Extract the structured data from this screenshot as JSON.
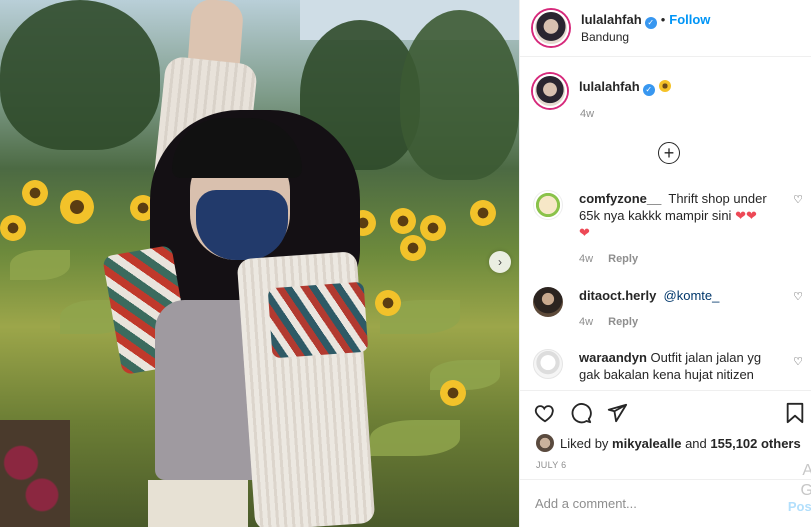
{
  "post": {
    "username": "lulalahfah",
    "location": "Bandung",
    "follow_label": "Follow",
    "separator": "•",
    "verified_icon": "verified-check-icon",
    "caption_time": "4w"
  },
  "comments": [
    {
      "user": "comfyzone__",
      "text": "Thrift shop under 65k nya kakkk mampir sini",
      "time": "4w",
      "reply": "Reply"
    },
    {
      "user": "ditaoct.herly",
      "text": "@komte_",
      "time": "4w",
      "reply": "Reply"
    },
    {
      "user": "waraandyn",
      "text": "Outfit jalan jalan yg gak bakalan kena hujat nitizen"
    }
  ],
  "likes": {
    "prefix": "Liked by",
    "user": "mikyalealle",
    "and": "and",
    "count": "155,102 others"
  },
  "date": "JULY 6",
  "add_comment": {
    "placeholder": "Add a comment...",
    "post_label": "Post"
  },
  "colors": {
    "accent": "#0095f6",
    "heart": "#ed4956",
    "muted": "#8e8e8e",
    "post_disabled": "#b2dffc"
  },
  "edge_glyphs": [
    "A",
    "G"
  ]
}
